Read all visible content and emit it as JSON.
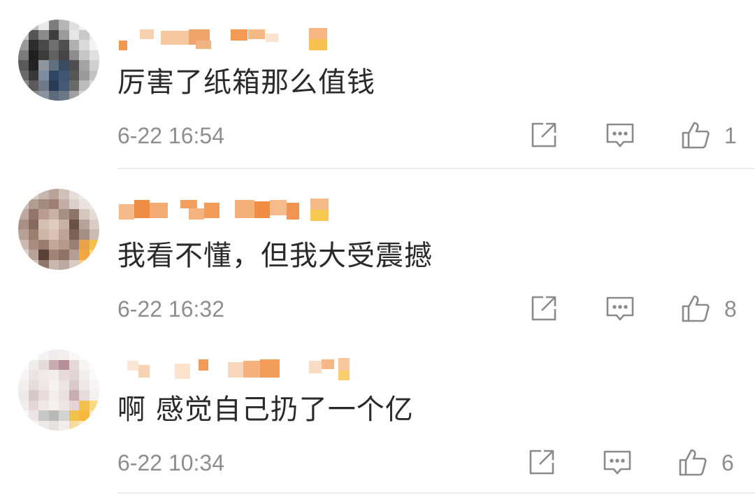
{
  "comments": [
    {
      "username": "",
      "text": "厉害了纸箱那么值钱",
      "time": "6-22 16:54",
      "likes": "1",
      "icons": {
        "share": "share-icon",
        "reply": "comment-icon",
        "like": "thumbs-up-icon"
      }
    },
    {
      "username": "",
      "text": "我看不懂，但我大受震撼",
      "time": "6-22 16:32",
      "likes": "8",
      "icons": {
        "share": "share-icon",
        "reply": "comment-icon",
        "like": "thumbs-up-icon"
      }
    },
    {
      "username": "",
      "text": "啊 感觉自己扔了一个亿",
      "time": "6-22 10:34",
      "likes": "6",
      "icons": {
        "share": "share-icon",
        "reply": "comment-icon",
        "like": "thumbs-up-icon"
      }
    }
  ],
  "colors": {
    "text": "#2a2a2a",
    "meta": "#8e8e8e",
    "icon": "#8a8a8a",
    "divider": "#ededed",
    "blur_orange": "#f08a3c"
  }
}
